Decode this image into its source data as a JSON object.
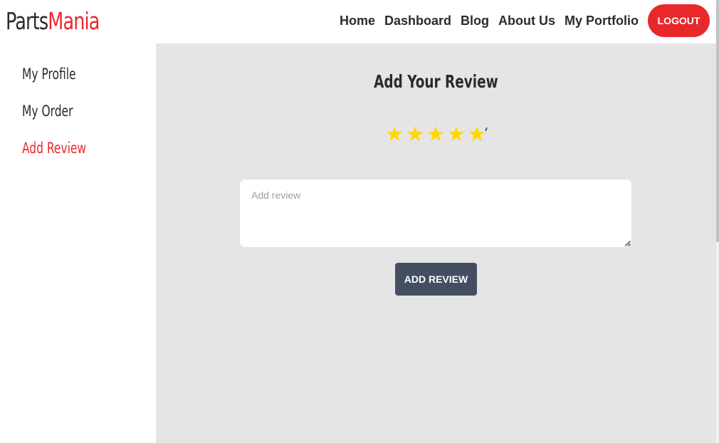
{
  "brand": {
    "part1": "Parts",
    "part2": "Mania"
  },
  "nav": {
    "links": [
      "Home",
      "Dashboard",
      "Blog",
      "About Us",
      "My Portfolio"
    ],
    "logout_label": "LOGOUT"
  },
  "sidebar": {
    "items": [
      {
        "label": "My Profile",
        "active": false
      },
      {
        "label": "My Order",
        "active": false
      },
      {
        "label": "Add Review",
        "active": true
      }
    ]
  },
  "review": {
    "title": "Add Your Review",
    "rating": 5,
    "rating_max": 5,
    "textarea_value": "",
    "textarea_placeholder": "Add review",
    "submit_label": "ADD REVIEW"
  },
  "colors": {
    "accent": "#e8282b",
    "star": "#ffd700",
    "button_dark": "#434f61",
    "main_bg": "#e5e5e5"
  },
  "icons": {
    "star": "star-icon",
    "resize": "resize-grip-icon"
  }
}
